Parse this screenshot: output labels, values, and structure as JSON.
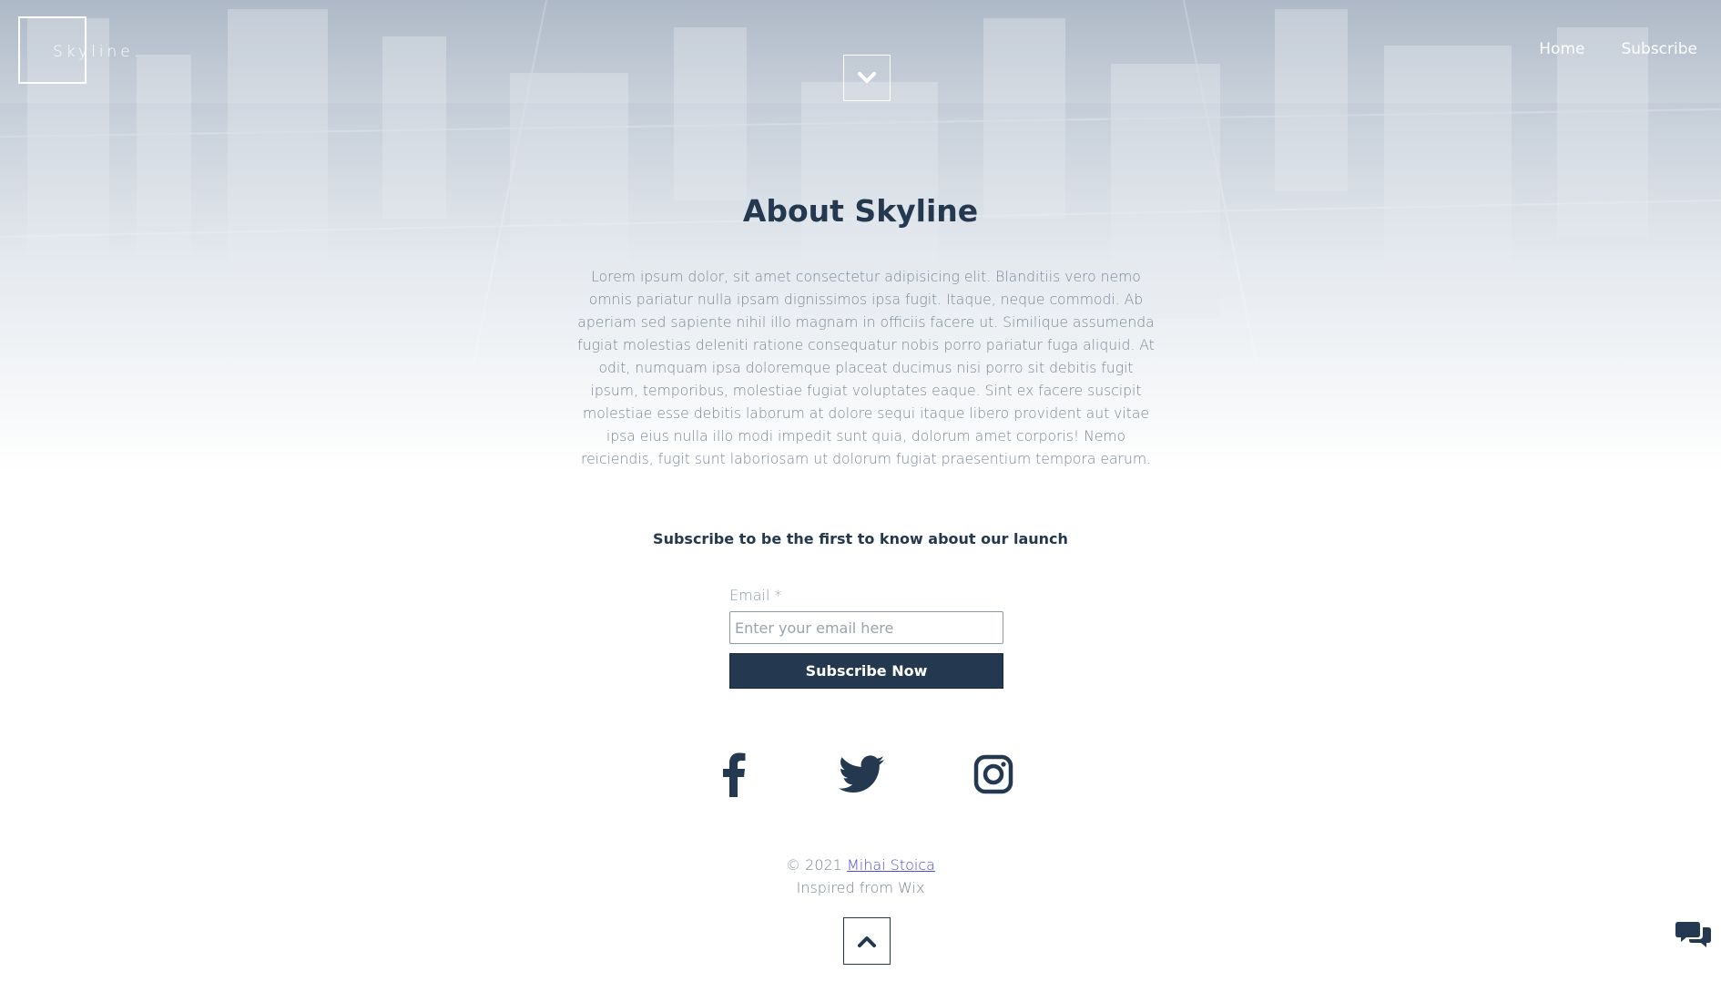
{
  "header": {
    "logo_text": "Skyline.",
    "nav": [
      {
        "label": "Home"
      },
      {
        "label": "Subscribe"
      }
    ],
    "scroll_down_icon": "chevron-down-icon"
  },
  "about": {
    "title": "About Skyline",
    "body": "Lorem ipsum dolor, sit amet consectetur adipisicing elit. Blanditiis vero nemo omnis pariatur nulla ipsam dignissimos ipsa fugit. Itaque, neque commodi. Ab aperiam sed sapiente nihil illo magnam in officiis facere ut. Similique assumenda fugiat molestias deleniti ratione consequatur nobis porro pariatur fuga aliquid. At odit, numquam ipsa doloremque placeat ducimus nisi porro sit debitis fugit ipsum, temporibus, molestiae fugiat voluptates eaque. Sint ex facere suscipit molestiae esse debitis laborum at dolore sequi itaque libero provident aut vitae ipsa eius nulla illo modi impedit sunt quia, dolorum amet corporis! Nemo reiciendis, fugit sunt laboriosam ut dolorum fugiat praesentium tempora earum."
  },
  "subscribe": {
    "heading": "Subscribe to be the first to know about our launch",
    "email_label": "Email *",
    "email_value": "",
    "email_placeholder": "Enter your email here",
    "button_label": "Subscribe Now"
  },
  "social": [
    {
      "icon": "facebook-icon"
    },
    {
      "icon": "twitter-icon"
    },
    {
      "icon": "instagram-icon"
    }
  ],
  "footer": {
    "copyright": "© 2021",
    "author_link": "Mihai Stoica",
    "inspired": "Inspired from Wix",
    "scroll_up_icon": "chevron-up-icon"
  },
  "chat": {
    "icon": "chat-bubbles-icon"
  },
  "colors": {
    "primary": "#24394f",
    "muted_text": "#7a8796",
    "link": "#4b4bd6",
    "header_white": "#ffffff"
  }
}
